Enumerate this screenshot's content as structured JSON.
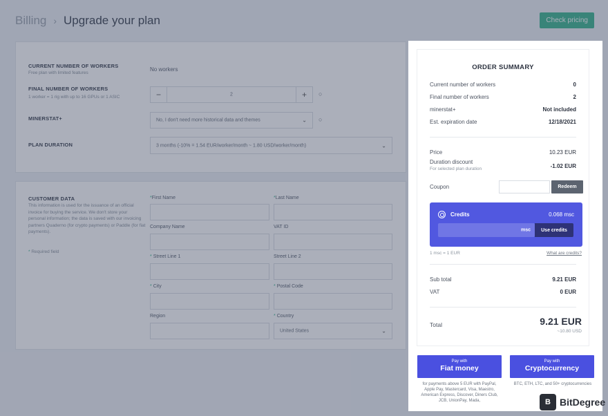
{
  "breadcrumb": {
    "root": "Billing",
    "separator": "›",
    "current": "Upgrade your plan"
  },
  "header": {
    "check_pricing": "Check pricing"
  },
  "plan": {
    "current_workers_label": "CURRENT NUMBER OF WORKERS",
    "current_workers_sub": "Free plan with limited features",
    "current_workers_value": "No workers",
    "final_workers_label": "FINAL NUMBER OF WORKERS",
    "final_workers_sub": "1 worker = 1 rig with up to 16 GPUs or 1 ASIC",
    "final_workers_value": "2",
    "minerstat_label": "MINERSTAT+",
    "minerstat_value": "No, I don't need more historical data and themes",
    "duration_label": "PLAN DURATION",
    "duration_value": "3 months (-10% = 1.54 EUR/worker/month ~ 1.80 USD/worker/month)"
  },
  "customer": {
    "title": "CUSTOMER DATA",
    "description": "This information is used for the issuance of an official invoice for buying the service. We don't store your personal information; the data is saved with our invoicing partners Quaderno (for crypto payments) or Paddle (for fiat payments).",
    "required_note": "Required field",
    "first_name": "First Name",
    "last_name": "Last Name",
    "company_name": "Company Name",
    "vat_id": "VAT ID",
    "street1": "Street Line 1",
    "street2": "Street Line 2",
    "city": "City",
    "postal_code": "Postal Code",
    "region": "Region",
    "country": "Country",
    "country_value": "United States"
  },
  "summary": {
    "title": "ORDER SUMMARY",
    "rows": [
      {
        "label": "Current number of workers",
        "value": "0"
      },
      {
        "label": "Final number of workers",
        "value": "2"
      },
      {
        "label": "minerstat+",
        "value": "Not included"
      },
      {
        "label": "Est. expiration date",
        "value": "12/18/2021"
      }
    ],
    "price_label": "Price",
    "price_value": "10.23 EUR",
    "discount_label": "Duration discount",
    "discount_sub": "For selected plan duration",
    "discount_value": "-1.02 EUR",
    "coupon_label": "Coupon",
    "redeem": "Redeem",
    "credits_title": "Credits",
    "credits_value": "0.068 msc",
    "credits_unit": "msc",
    "use_credits": "Use credits",
    "rate": "1 msc = 1 EUR",
    "what_credits": "What are credits?",
    "subtotal_label": "Sub total",
    "subtotal_value": "9.21 EUR",
    "vat_label": "VAT",
    "vat_value": "0 EUR",
    "total_label": "Total",
    "total_value": "9.21 EUR",
    "total_usd": "~10.80 USD"
  },
  "payment": {
    "pay_with": "Pay with",
    "fiat": "Fiat money",
    "crypto": "Cryptocurrency",
    "fiat_note": "for payments above 5 EUR with PayPal, Apple Pay, Mastercard, Visa, Maestro, American Express, Discover, Diners Club, JCB, UnionPay, Mada,",
    "crypto_note": "BTC, ETH, LTC, and 50+ cryptocurrencies"
  },
  "watermark": {
    "logo": "B",
    "text": "BitDegree"
  },
  "colors": {
    "accent_green": "#3bb68f",
    "accent_blue": "#4a50e0",
    "credits_bg": "#5158e0"
  }
}
